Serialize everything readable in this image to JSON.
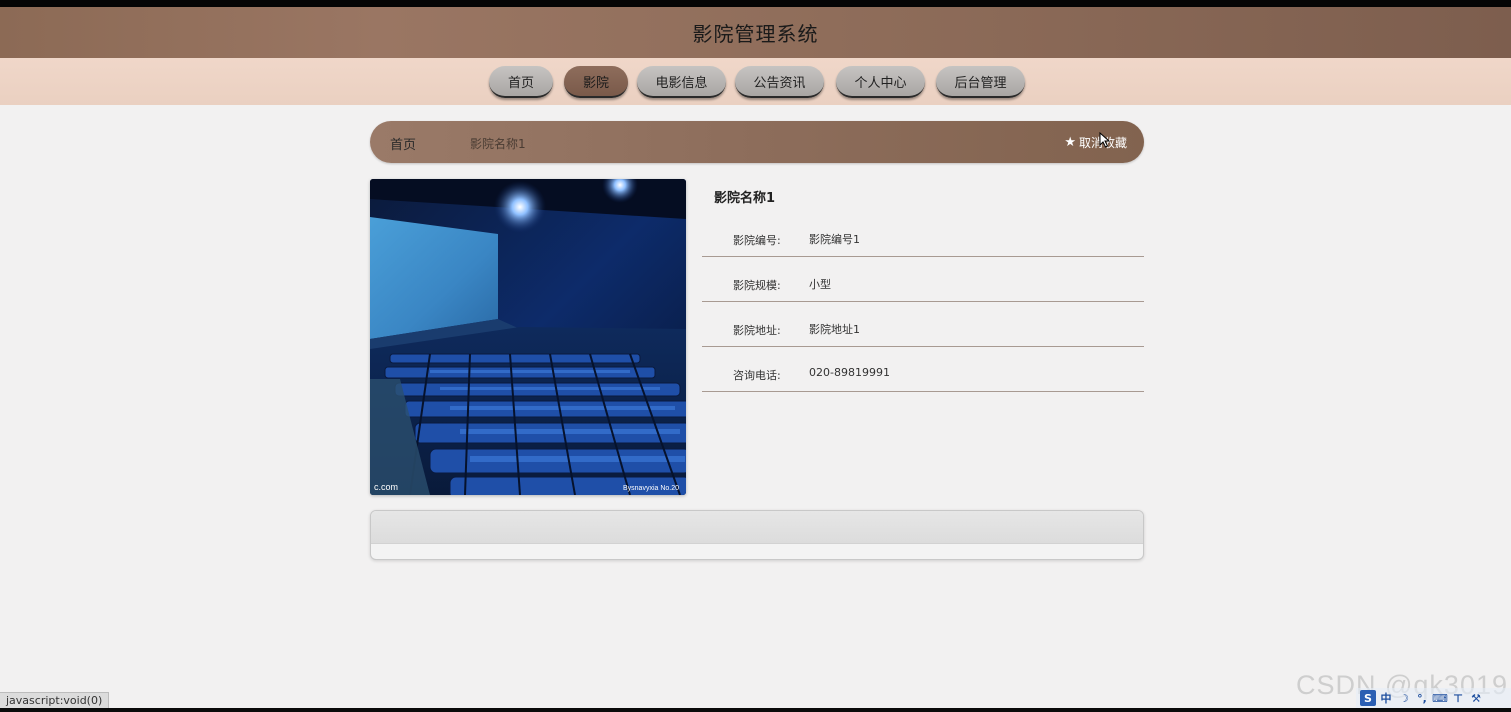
{
  "header": {
    "title": "影院管理系统"
  },
  "nav": {
    "items": [
      {
        "label": "首页"
      },
      {
        "label": "影院",
        "active": true
      },
      {
        "label": "电影信息"
      },
      {
        "label": "公告资讯"
      },
      {
        "label": "个人中心"
      },
      {
        "label": "后台管理"
      }
    ]
  },
  "breadcrumb": {
    "home": "首页",
    "current": "影院名称1",
    "favorite_label": "取消收藏",
    "favorite_icon": "star-icon"
  },
  "cinema": {
    "name": "影院名称1",
    "image_caption_left": "c.com",
    "image_caption_right": "Bysnavyxia No.20",
    "fields": [
      {
        "label": "影院编号:",
        "value": "影院编号1"
      },
      {
        "label": "影院规模:",
        "value": "小型"
      },
      {
        "label": "影院地址:",
        "value": "影院地址1"
      },
      {
        "label": "咨询电话:",
        "value": "020-89819991"
      }
    ]
  },
  "status_bar": {
    "text": "javascript:void(0)"
  },
  "watermark": {
    "text": "CSDN @qk3019"
  },
  "ime": {
    "mode_label": "中"
  },
  "colors": {
    "header_brown": "#8c6a55",
    "nav_background": "#ead0c1",
    "nav_active": "#7a5a4a",
    "nav_inactive": "#b2afac",
    "page_background": "#f2f1f1"
  }
}
